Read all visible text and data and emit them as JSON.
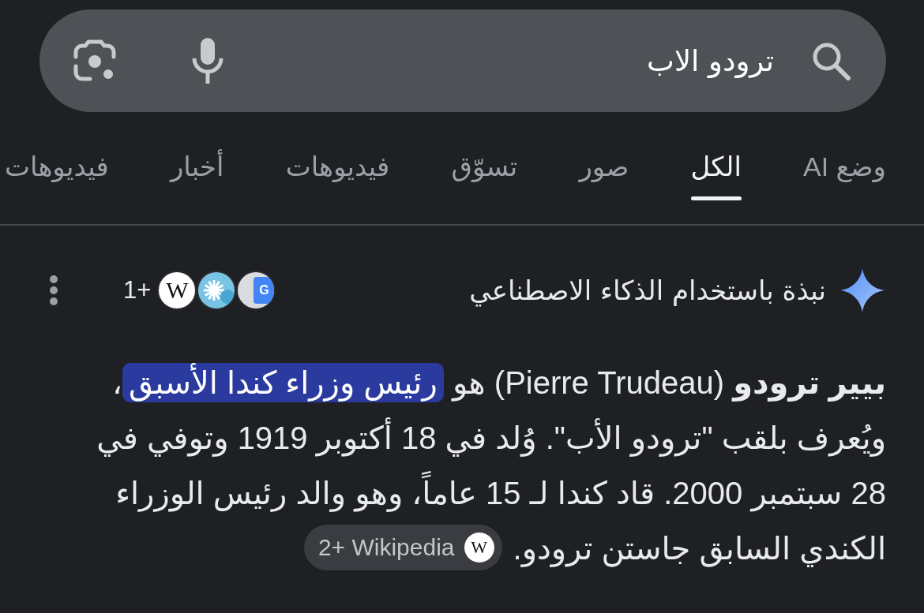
{
  "search": {
    "query": "ترودو الاب"
  },
  "tabs": [
    {
      "label": "وضع AI",
      "selected": false
    },
    {
      "label": "الكل",
      "selected": true
    },
    {
      "label": "صور",
      "selected": false
    },
    {
      "label": "تسوّق",
      "selected": false
    },
    {
      "label": "فيديوهات",
      "selected": false
    },
    {
      "label": "أخبار",
      "selected": false
    },
    {
      "label": "فيديوهات",
      "selected": false
    }
  ],
  "overview": {
    "title": "نبذة باستخدام الذكاء الاصطناعي",
    "sources": [
      {
        "kind": "translate",
        "glyph": "G"
      },
      {
        "kind": "image"
      },
      {
        "kind": "wikipedia",
        "glyph": "W"
      }
    ],
    "more_sources": "1+",
    "segments": [
      {
        "text": "**بيير ترودو** (Pierre Trudeau) هو ",
        "highlighted": false
      },
      {
        "text": "رئيس وزراء كندا الأسبق",
        "highlighted": true
      },
      {
        "text": "، ويُعرف بلقب \"ترودو الأب\". وُلد في 18 أكتوبر 1919 وتوفي في 28 سبتمبر 2000. قاد كندا لـ 15 عاماً، وهو والد رئيس الوزراء الكندي السابق جاستن ترودو.",
        "highlighted": false
      }
    ],
    "source_chip": {
      "label": "2+ Wikipedia",
      "glyph": "W"
    }
  }
}
